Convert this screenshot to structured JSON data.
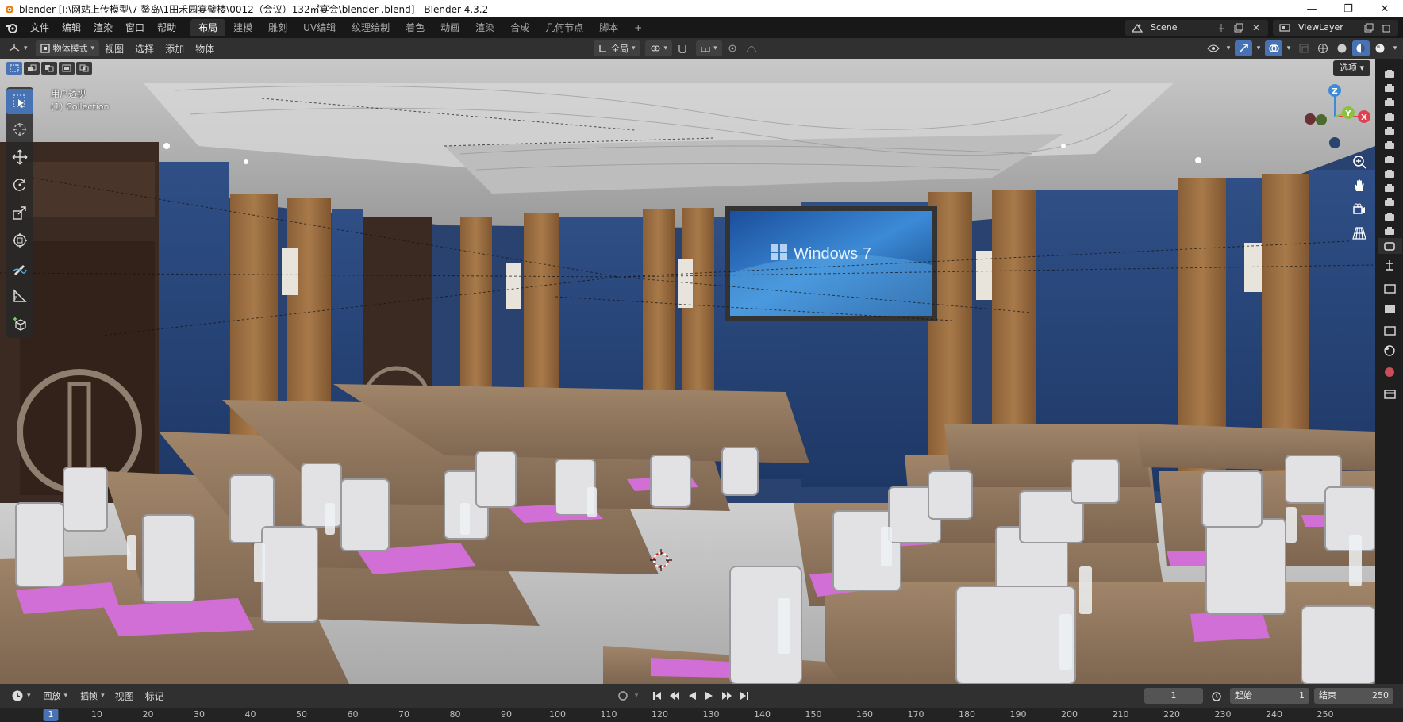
{
  "window": {
    "title": "blender  [I:\\网站上传模型\\7 鳌岛\\1田禾园宴璧楼\\0012（会议）132㎡宴会\\blender .blend] - Blender 4.3.2",
    "minimize": "—",
    "maximize": "❐",
    "close": "✕"
  },
  "menubar": {
    "items": [
      "文件",
      "编辑",
      "渲染",
      "窗口",
      "帮助"
    ]
  },
  "workspaces": {
    "tabs": [
      "布局",
      "建模",
      "雕刻",
      "UV编辑",
      "纹理绘制",
      "着色",
      "动画",
      "渲染",
      "合成",
      "几何节点",
      "脚本"
    ],
    "active": "布局",
    "add": "+"
  },
  "scene": {
    "name": "Scene",
    "view_layer": "ViewLayer"
  },
  "viewport_header": {
    "mode": "物体模式",
    "menus": [
      "视图",
      "选择",
      "添加",
      "物体"
    ],
    "transform_orientation": "全局",
    "options": "选项"
  },
  "viewport": {
    "view_name": "用户透视",
    "collection": "(1) Collection",
    "screen_text": "Windows 7",
    "axis_x": "X",
    "axis_y": "Y",
    "axis_z": "Z"
  },
  "timeline": {
    "playback": "回放",
    "keying": "插帧",
    "view": "视图",
    "marker": "标记",
    "current_frame": "1",
    "start_label": "起始",
    "start": "1",
    "end_label": "结束",
    "end": "250",
    "ruler_current": "1",
    "ruler_ticks": [
      "10",
      "20",
      "30",
      "40",
      "50",
      "60",
      "70",
      "80",
      "90",
      "100",
      "110",
      "120",
      "130",
      "140",
      "150",
      "160",
      "170",
      "180",
      "190",
      "200",
      "210",
      "220",
      "230",
      "240",
      "250"
    ]
  },
  "colors": {
    "accent": "#4772b3",
    "panel": "#303030",
    "topbar": "#181818",
    "axis_x": "#e04050",
    "axis_y": "#8cc040",
    "axis_z": "#3d8ad8"
  }
}
